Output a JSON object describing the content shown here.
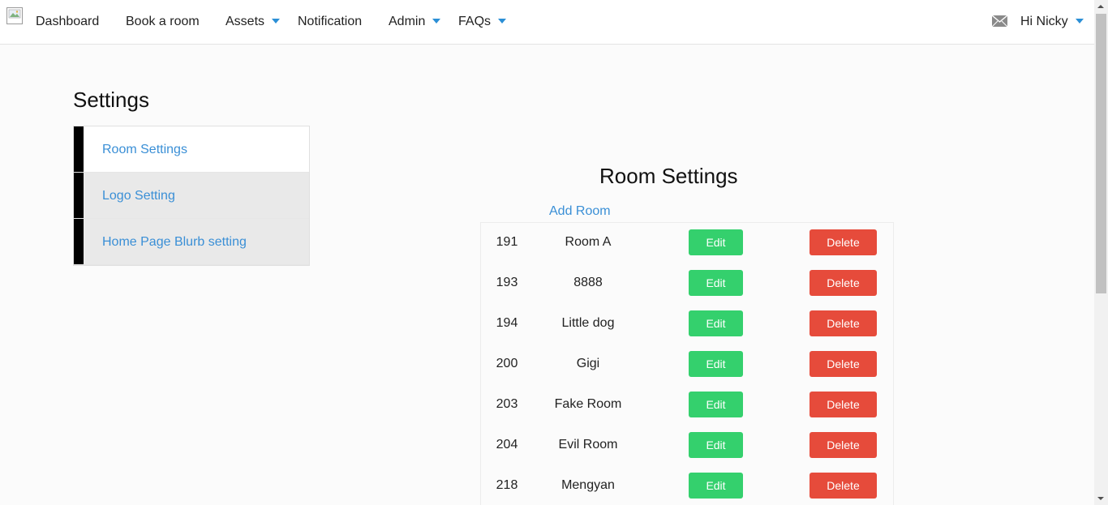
{
  "nav": {
    "items": [
      {
        "label": "Dashboard",
        "dropdown": false
      },
      {
        "label": "Book a room",
        "dropdown": false
      },
      {
        "label": "Assets",
        "dropdown": true
      },
      {
        "label": "Notification",
        "dropdown": false
      },
      {
        "label": "Admin",
        "dropdown": true
      },
      {
        "label": "FAQs",
        "dropdown": true
      }
    ],
    "user_greeting": "Hi Nicky",
    "mail_icon": "envelope-icon",
    "accent_color": "#2b8fd6"
  },
  "sidebar": {
    "heading": "Settings",
    "items": [
      {
        "label": "Room Settings",
        "active": true
      },
      {
        "label": "Logo Setting",
        "active": false
      },
      {
        "label": "Home Page Blurb setting",
        "active": false
      }
    ]
  },
  "rooms": {
    "title": "Room Settings",
    "add_label": "Add Room",
    "edit_label": "Edit",
    "delete_label": "Delete",
    "edit_color": "#34d06d",
    "delete_color": "#e64b3b",
    "rows": [
      {
        "id": "191",
        "name": "Room A"
      },
      {
        "id": "193",
        "name": "8888"
      },
      {
        "id": "194",
        "name": "Little dog"
      },
      {
        "id": "200",
        "name": "Gigi"
      },
      {
        "id": "203",
        "name": "Fake Room"
      },
      {
        "id": "204",
        "name": "Evil Room"
      },
      {
        "id": "218",
        "name": "Mengyan"
      }
    ]
  }
}
